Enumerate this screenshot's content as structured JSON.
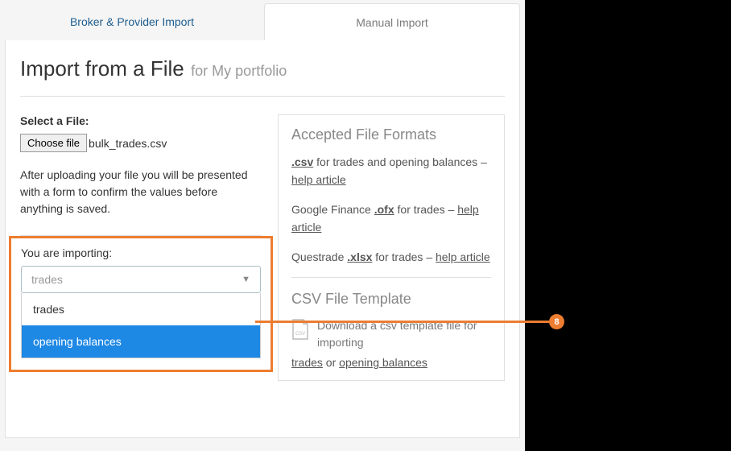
{
  "tabs": {
    "broker": "Broker & Provider Import",
    "manual": "Manual Import"
  },
  "title": {
    "main": "Import from a File",
    "sub": "for My portfolio"
  },
  "fileSelect": {
    "label": "Select a File:",
    "button": "Choose file",
    "filename": "bulk_trades.csv"
  },
  "helper": "After uploading your file you will be presented with a form to confirm the values before anything is saved.",
  "importing": {
    "label": "You are importing:",
    "selected": "trades",
    "options": [
      "trades",
      "opening balances"
    ]
  },
  "formats": {
    "title": "Accepted File Formats",
    "csv": {
      "ext": ".csv",
      "text": " for trades and opening balances – ",
      "help": "help article"
    },
    "ofx": {
      "prefix": "Google Finance ",
      "ext": ".ofx",
      "text": " for trades – ",
      "help": "help article"
    },
    "xlsx": {
      "prefix": "Questrade ",
      "ext": ".xlsx",
      "text": " for trades – ",
      "help": "help article"
    }
  },
  "template": {
    "title": "CSV File Template",
    "desc": "Download a csv template file for importing",
    "link1": "trades",
    "or": " or ",
    "link2": "opening balances"
  },
  "callout": {
    "num": "8"
  }
}
